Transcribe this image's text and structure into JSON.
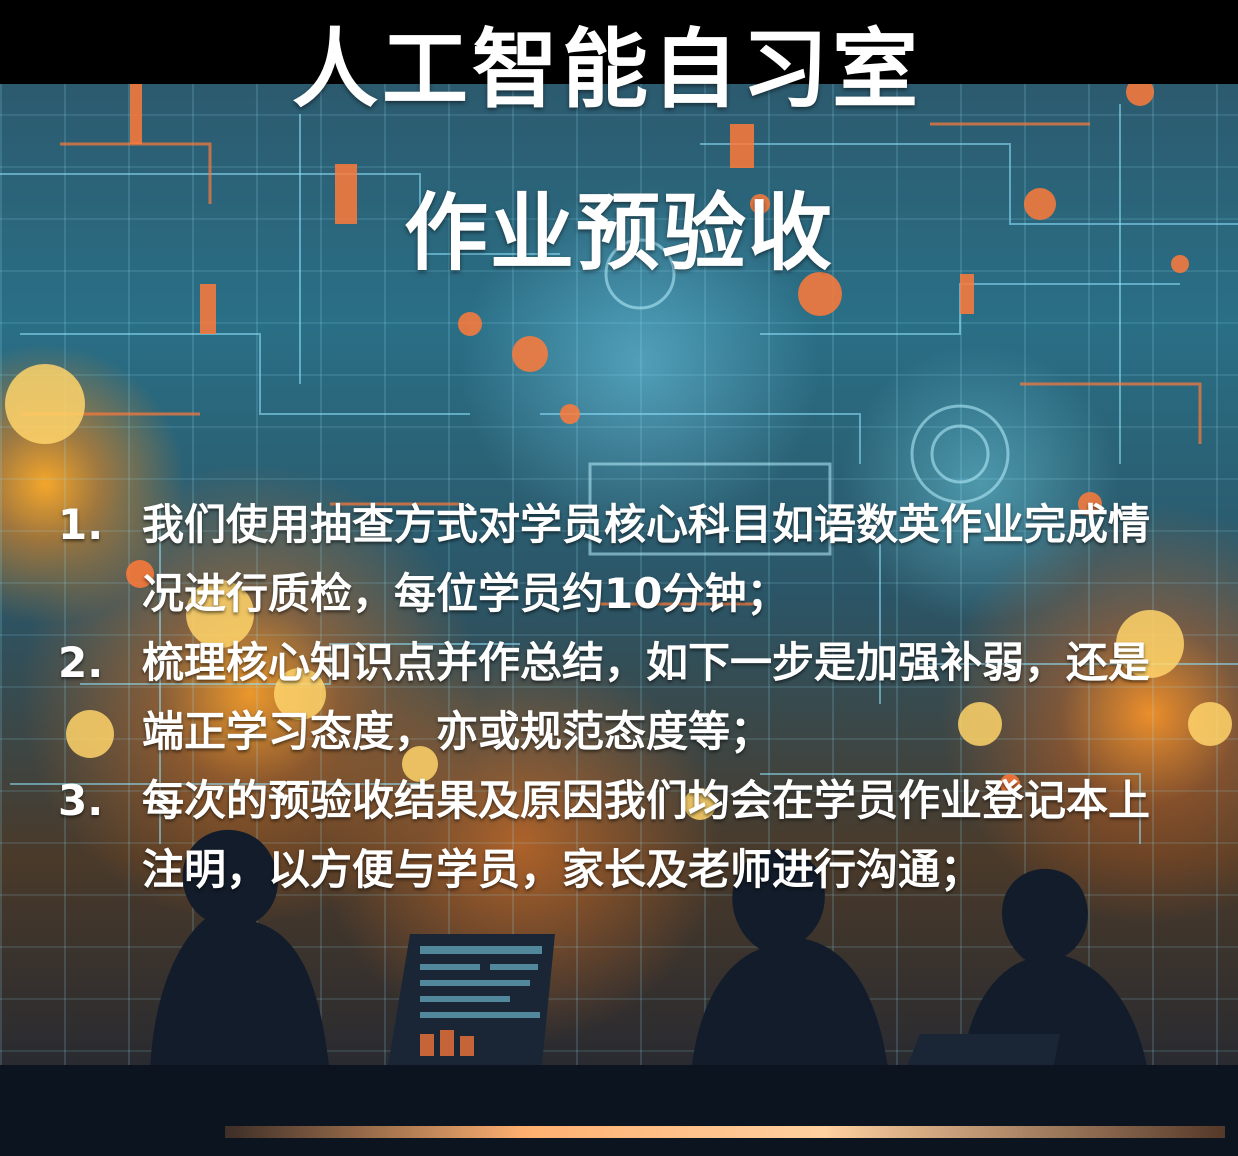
{
  "title": "人工智能自习室",
  "subtitle": "作业预验收",
  "items": [
    {
      "number": "1.",
      "text": "我们使用抽查方式对学员核心科目如语数英作业完成情况进行质检，每位学员约10分钟；"
    },
    {
      "number": "2.",
      "text": "梳理核心知识点并作总结，如下一步是加强补弱，还是端正学习态度，亦或规范态度等；"
    },
    {
      "number": "3.",
      "text": "每次的预验收结果及原因我们均会在学员作业登记本上注明，以方便与学员，家长及老师进行沟通；"
    }
  ],
  "colors": {
    "text": "#ffffff",
    "top_bar": "#000000",
    "accent_orange": "#ff7a3a",
    "accent_cyan": "#7fd8f0"
  }
}
